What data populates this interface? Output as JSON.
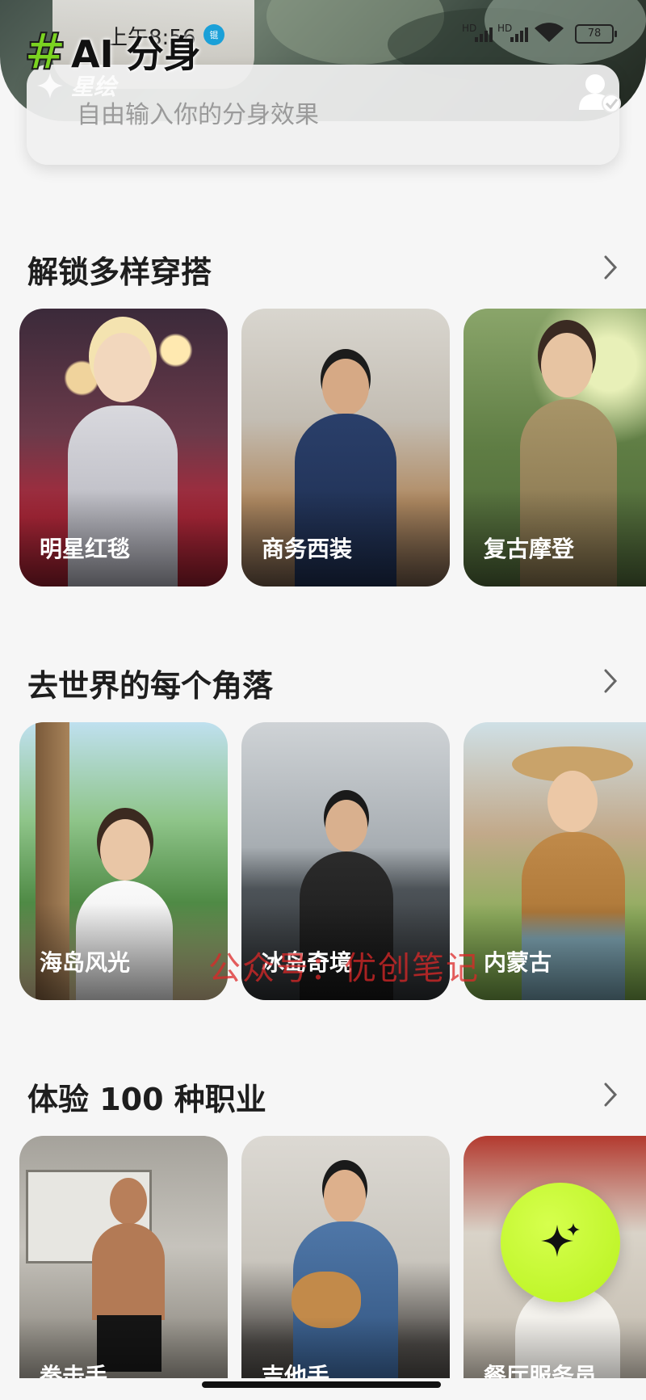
{
  "status_bar": {
    "time": "上午8:56",
    "time_badge": "锟",
    "signal1": "HD",
    "signal2": "HD",
    "battery": "78"
  },
  "header": {
    "logo_hash": "#",
    "logo_text": "AI 分身",
    "sub_logo": "星绘",
    "input_placeholder": "自由输入你的分身效果"
  },
  "sections": [
    {
      "title": "解锁多样穿搭",
      "cards": [
        {
          "label": "明星红毯"
        },
        {
          "label": "商务西装"
        },
        {
          "label": "复古摩登"
        }
      ]
    },
    {
      "title": "去世界的每个角落",
      "cards": [
        {
          "label": "海岛风光"
        },
        {
          "label": "冰岛奇境"
        },
        {
          "label": "内蒙古"
        }
      ]
    },
    {
      "title": "体验 100 种职业",
      "cards": [
        {
          "label": "拳击手"
        },
        {
          "label": "吉他手"
        },
        {
          "label": "餐厅服务员"
        }
      ]
    }
  ],
  "watermark": "公众号：优创笔记",
  "icons": {
    "chevron": "chevron-right-icon",
    "fab": "sparkle-icon",
    "user": "user-check-icon"
  },
  "colors": {
    "accent_green": "#b8f21e",
    "logo_green": "#7bd321",
    "background": "#f6f6f6"
  }
}
